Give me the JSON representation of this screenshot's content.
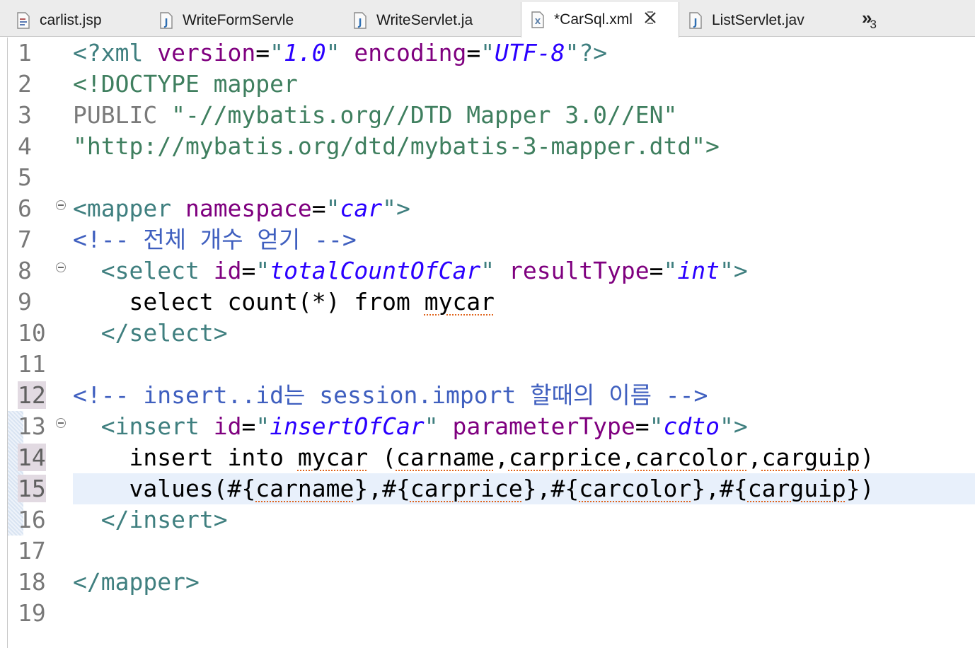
{
  "tabs": [
    {
      "label": "carlist.jsp",
      "icon": "jsp-file-icon",
      "active": false,
      "dirty": false
    },
    {
      "label": "WriteFormServle",
      "icon": "java-file-icon",
      "active": false,
      "dirty": false
    },
    {
      "label": "WriteServlet.ja",
      "icon": "java-file-icon",
      "active": false,
      "dirty": false
    },
    {
      "label": "*CarSql.xml",
      "icon": "xml-file-icon",
      "active": true,
      "dirty": true
    },
    {
      "label": "ListServlet.jav",
      "icon": "java-file-icon",
      "active": false,
      "dirty": false
    }
  ],
  "overflow": {
    "chevron": "»",
    "count": "3"
  },
  "editor": {
    "current_line": 15,
    "lines": [
      {
        "num": "1",
        "tokens": [
          [
            "tg",
            "<?xml "
          ],
          [
            "at",
            "version"
          ],
          [
            "tx",
            "="
          ],
          [
            "tg",
            "\""
          ],
          [
            "val",
            "1.0"
          ],
          [
            "tg",
            "\" "
          ],
          [
            "at",
            "encoding"
          ],
          [
            "tx",
            "="
          ],
          [
            "tg",
            "\""
          ],
          [
            "val",
            "UTF-8"
          ],
          [
            "tg",
            "\"?>"
          ]
        ]
      },
      {
        "num": "2",
        "tokens": [
          [
            "dt",
            "<!DOCTYPE mapper"
          ]
        ]
      },
      {
        "num": "3",
        "tokens": [
          [
            "dtk",
            "PUBLIC "
          ],
          [
            "dt",
            "\"-//mybatis.org//DTD Mapper 3.0//EN\""
          ]
        ]
      },
      {
        "num": "4",
        "tokens": [
          [
            "dt",
            "\"http://mybatis.org/dtd/mybatis-3-mapper.dtd\">"
          ]
        ]
      },
      {
        "num": "5",
        "tokens": []
      },
      {
        "num": "6",
        "fold": true,
        "tokens": [
          [
            "tg",
            "<mapper "
          ],
          [
            "at",
            "namespace"
          ],
          [
            "tx",
            "="
          ],
          [
            "tg",
            "\""
          ],
          [
            "val",
            "car"
          ],
          [
            "tg",
            "\">"
          ]
        ]
      },
      {
        "num": "7",
        "tokens": [
          [
            "cm",
            "<!-- 전체 개수 얻기 -->"
          ]
        ]
      },
      {
        "num": "8",
        "fold": true,
        "tokens": [
          [
            "tx",
            "  "
          ],
          [
            "tg",
            "<select "
          ],
          [
            "at",
            "id"
          ],
          [
            "tx",
            "="
          ],
          [
            "tg",
            "\""
          ],
          [
            "val",
            "totalCountOfCar"
          ],
          [
            "tg",
            "\" "
          ],
          [
            "at",
            "resultType"
          ],
          [
            "tx",
            "="
          ],
          [
            "tg",
            "\""
          ],
          [
            "val",
            "int"
          ],
          [
            "tg",
            "\">"
          ]
        ]
      },
      {
        "num": "9",
        "tokens": [
          [
            "tx",
            "    select count(*) from "
          ],
          [
            "tx sp",
            "mycar"
          ]
        ]
      },
      {
        "num": "10",
        "tokens": [
          [
            "tx",
            "  "
          ],
          [
            "tg",
            "</select>"
          ]
        ]
      },
      {
        "num": "11",
        "tokens": []
      },
      {
        "num": "12",
        "hl": true,
        "tokens": [
          [
            "cm",
            "<!-- insert..id는 session.import 할때의 이름 -->"
          ]
        ]
      },
      {
        "num": "13",
        "fold": true,
        "tokens": [
          [
            "tx",
            "  "
          ],
          [
            "tg",
            "<insert "
          ],
          [
            "at",
            "id"
          ],
          [
            "tx",
            "="
          ],
          [
            "tg",
            "\""
          ],
          [
            "val",
            "insertOfCar"
          ],
          [
            "tg",
            "\" "
          ],
          [
            "at",
            "parameterType"
          ],
          [
            "tx",
            "="
          ],
          [
            "tg",
            "\""
          ],
          [
            "val",
            "cdto"
          ],
          [
            "tg",
            "\">"
          ]
        ]
      },
      {
        "num": "14",
        "hl": true,
        "tokens": [
          [
            "tx",
            "    insert into "
          ],
          [
            "tx sp",
            "mycar"
          ],
          [
            "tx",
            " ("
          ],
          [
            "tx sp",
            "carname"
          ],
          [
            "tx",
            ","
          ],
          [
            "tx sp",
            "carprice"
          ],
          [
            "tx",
            ","
          ],
          [
            "tx sp",
            "carcolor"
          ],
          [
            "tx",
            ","
          ],
          [
            "tx sp",
            "carguip"
          ],
          [
            "tx",
            ")"
          ]
        ]
      },
      {
        "num": "15",
        "hl": true,
        "tokens": [
          [
            "tx",
            "    values(#{"
          ],
          [
            "tx sp",
            "carname"
          ],
          [
            "tx",
            "},#{"
          ],
          [
            "tx sp",
            "carprice"
          ],
          [
            "tx",
            "},#{"
          ],
          [
            "tx sp",
            "carcolor"
          ],
          [
            "tx",
            "},#{"
          ],
          [
            "tx sp",
            "carguip"
          ],
          [
            "tx",
            "})"
          ]
        ]
      },
      {
        "num": "16",
        "tokens": [
          [
            "tx",
            "  "
          ],
          [
            "tg",
            "</insert>"
          ]
        ]
      },
      {
        "num": "17",
        "tokens": []
      },
      {
        "num": "18",
        "tokens": [
          [
            "tg",
            "</mapper>"
          ]
        ]
      },
      {
        "num": "19",
        "tokens": []
      }
    ]
  }
}
